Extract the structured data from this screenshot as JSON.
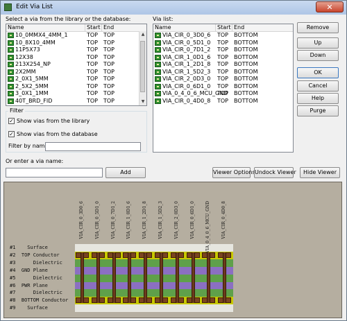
{
  "window": {
    "title": "Edit Via List",
    "close_label": "✕"
  },
  "library": {
    "label": "Select a via from the library or the database:",
    "columns": [
      "Name",
      "Start",
      "End"
    ],
    "rows": [
      {
        "name": "10_0MMX4_4MM_1",
        "start": "TOP",
        "end": "TOP"
      },
      {
        "name": "10_8X10_4MM",
        "start": "TOP",
        "end": "TOP"
      },
      {
        "name": "11P5X73",
        "start": "TOP",
        "end": "TOP"
      },
      {
        "name": "12X38",
        "start": "TOP",
        "end": "TOP"
      },
      {
        "name": "213X254_NP",
        "start": "TOP",
        "end": "TOP"
      },
      {
        "name": "2X2MM",
        "start": "TOP",
        "end": "TOP"
      },
      {
        "name": "2_0X1_5MM",
        "start": "TOP",
        "end": "TOP"
      },
      {
        "name": "2_5X2_5MM",
        "start": "TOP",
        "end": "TOP"
      },
      {
        "name": "3_0X1_1MM",
        "start": "TOP",
        "end": "TOP"
      },
      {
        "name": "40T_BRD_FID",
        "start": "TOP",
        "end": "TOP"
      }
    ]
  },
  "via_list": {
    "label": "Via list:",
    "columns": [
      "Name",
      "Start",
      "End"
    ],
    "rows": [
      {
        "name": "VIA_CIR_0_3D0_6",
        "start": "TOP",
        "end": "BOTTOM"
      },
      {
        "name": "VIA_CIR_0_5D1_0",
        "start": "TOP",
        "end": "BOTTOM"
      },
      {
        "name": "VIA_CIR_0_7D1_2",
        "start": "TOP",
        "end": "BOTTOM"
      },
      {
        "name": "VIA_CIR_1_0D1_6",
        "start": "TOP",
        "end": "BOTTOM"
      },
      {
        "name": "VIA_CIR_1_2D1_8",
        "start": "TOP",
        "end": "BOTTOM"
      },
      {
        "name": "VIA_CIR_1_5D2_3",
        "start": "TOP",
        "end": "BOTTOM"
      },
      {
        "name": "VIA_CIR_2_0D3_0",
        "start": "TOP",
        "end": "BOTTOM"
      },
      {
        "name": "VIA_CIR_0_6D1_0",
        "start": "TOP",
        "end": "BOTTOM"
      },
      {
        "name": "VIA_0_4_0_6_MCU_GND",
        "start": "TOP",
        "end": "BOTTOM"
      },
      {
        "name": "VIA_CIR_0_4D0_8",
        "start": "TOP",
        "end": "BOTTOM"
      }
    ]
  },
  "buttons": {
    "remove": "Remove",
    "up": "Up",
    "down": "Down",
    "ok": "OK",
    "cancel": "Cancel",
    "help": "Help",
    "purge": "Purge",
    "add": "Add",
    "viewer_options": "Viewer Options",
    "undock_viewer": "Undock Viewer",
    "hide_viewer": "Hide Viewer"
  },
  "filter": {
    "title": "Filter",
    "show_library": "Show vias from the library",
    "show_database": "Show vias from the database",
    "show_library_checked": true,
    "show_database_checked": true,
    "filter_by_name_label": "Filter by name:",
    "filter_by_name_value": ""
  },
  "enter_via": {
    "label": "Or enter a via name:",
    "value": ""
  },
  "viewer": {
    "via_names": [
      "VIA_CIR_0_3D0_6",
      "VIA_CIR_0_5D1_0",
      "VIA_CIR_0_7D1_2",
      "VIA_CIR_1_0D1_6",
      "VIA_CIR_1_2D1_8",
      "VIA_CIR_1_5D2_3",
      "VIA_CIR_2_0D3_0",
      "VIA_CIR_0_6D1_0",
      "VIA_0_4_0_6_MCU_GND",
      "VIA_CIR_0_4D0_8"
    ],
    "layers": [
      {
        "label": "#1    Surface",
        "color": "#e6e6df"
      },
      {
        "label": "#2  TOP Conductor",
        "color": "#c8c800"
      },
      {
        "label": "#3      Dielectric",
        "color": "#5fa04a"
      },
      {
        "label": "#4  GND Plane",
        "color": "#8b6fc2"
      },
      {
        "label": "#5      Dielectric",
        "color": "#5fa04a"
      },
      {
        "label": "#6  PWR Plane",
        "color": "#8b6fc2"
      },
      {
        "label": "#7      Dielectric",
        "color": "#5fa04a"
      },
      {
        "label": "#8  BOTTOM Conductor",
        "color": "#c8c800"
      },
      {
        "label": "#9    Surface",
        "color": "#e6e6df"
      }
    ]
  }
}
